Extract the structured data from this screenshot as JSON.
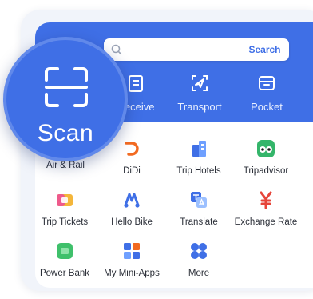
{
  "search": {
    "placeholder": "",
    "button_label": "Search"
  },
  "top_row": [
    {
      "label": "Receive",
      "icon": "receive-icon"
    },
    {
      "label": "Transport",
      "icon": "transport-icon"
    },
    {
      "label": "Pocket",
      "icon": "pocket-icon"
    }
  ],
  "scan": {
    "label": "Scan",
    "icon": "scan-frame-icon"
  },
  "grid_partial_label": "Air & Rail",
  "grid": [
    {
      "label": "DiDi",
      "icon": "didi-icon"
    },
    {
      "label": "Trip Hotels",
      "icon": "hotel-icon"
    },
    {
      "label": "Tripadvisor",
      "icon": "tripadvisor-icon"
    },
    {
      "label": "Trip Tickets",
      "icon": "tickets-icon"
    },
    {
      "label": "Hello Bike",
      "icon": "bike-icon"
    },
    {
      "label": "Translate",
      "icon": "translate-icon"
    },
    {
      "label": "Exchange Rate",
      "icon": "exchange-rate-icon"
    },
    {
      "label": "Power Bank",
      "icon": "power-bank-icon"
    },
    {
      "label": "My Mini-Apps",
      "icon": "mini-apps-icon"
    },
    {
      "label": "More",
      "icon": "more-icon"
    }
  ],
  "colors": {
    "brand_blue": "#3f6fe6",
    "didi_orange": "#f26a21",
    "tripadvisor_green": "#34b56a",
    "exchange_red": "#e6453a"
  }
}
